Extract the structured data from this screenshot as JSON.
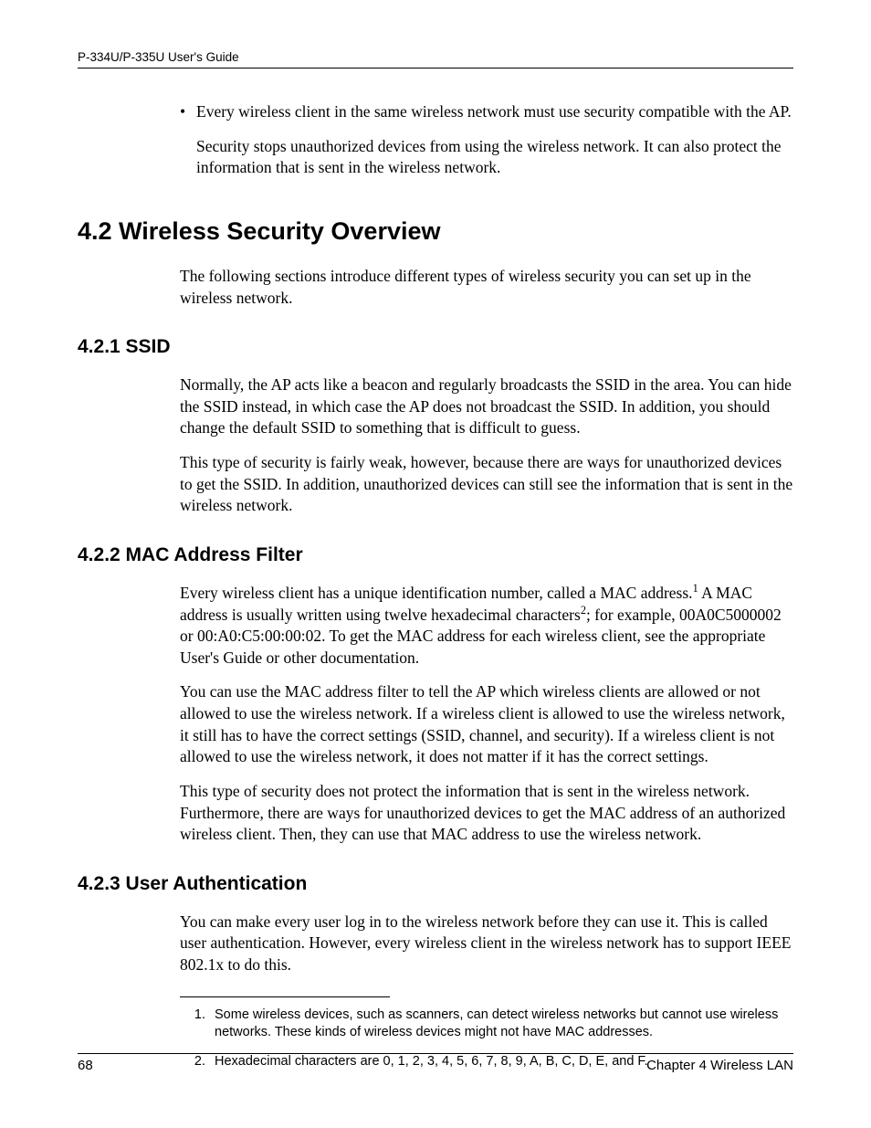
{
  "header": {
    "running": "P-334U/P-335U User's Guide"
  },
  "intro": {
    "bullet": "Every wireless client in the same wireless network must use security compatible with the AP.",
    "follow": "Security stops unauthorized devices from using the wireless network. It can also protect the information that is sent in the wireless network."
  },
  "s42": {
    "title": "4.2  Wireless Security Overview",
    "p1": "The following sections introduce different types of wireless security you can set up in the wireless network."
  },
  "s421": {
    "title": "4.2.1  SSID",
    "p1": "Normally, the AP acts like a beacon and regularly broadcasts the SSID in the area. You can hide the SSID instead, in which case the AP does not broadcast the SSID. In addition, you should change the default SSID to something that is difficult to guess.",
    "p2": "This type of security is fairly weak, however, because there are ways for unauthorized devices to get the SSID. In addition, unauthorized devices can still see the information that is sent in the wireless network."
  },
  "s422": {
    "title": "4.2.2  MAC Address Filter",
    "p1a": "Every wireless client has a unique identification number, called a MAC address.",
    "p1b": " A MAC address is usually written using twelve hexadecimal characters",
    "p1c": "; for example, 00A0C5000002 or 00:A0:C5:00:00:02. To get the MAC address for each wireless client, see the appropriate User's Guide or other documentation.",
    "p2": "You can use the MAC address filter to tell the AP which wireless clients are allowed or not allowed to use the wireless network. If a wireless client is allowed to use the wireless network, it still has to have the correct settings (SSID, channel, and security). If a wireless client is not allowed to use the wireless network, it does not matter if it has the correct settings.",
    "p3": "This type of security does not protect the information that is sent in the wireless network. Furthermore, there are ways for unauthorized devices to get the MAC address of an authorized wireless client. Then, they can use that MAC address to use the wireless network."
  },
  "s423": {
    "title": "4.2.3  User Authentication",
    "p1": "You can make every user log in to the wireless network before they can use it. This is called user authentication. However, every wireless client in the wireless network has to support IEEE 802.1x to do this."
  },
  "footnotes": {
    "n1": "1.",
    "t1": "Some wireless devices, such as scanners, can detect wireless networks but cannot use wireless networks. These kinds of wireless devices might not have MAC addresses.",
    "n2": "2.",
    "t2": "Hexadecimal characters are 0, 1, 2, 3, 4, 5, 6, 7, 8, 9, A, B, C, D, E, and F."
  },
  "footer": {
    "page": "68",
    "chapter": "Chapter 4 Wireless LAN"
  },
  "sup": {
    "one": "1",
    "two": "2"
  }
}
